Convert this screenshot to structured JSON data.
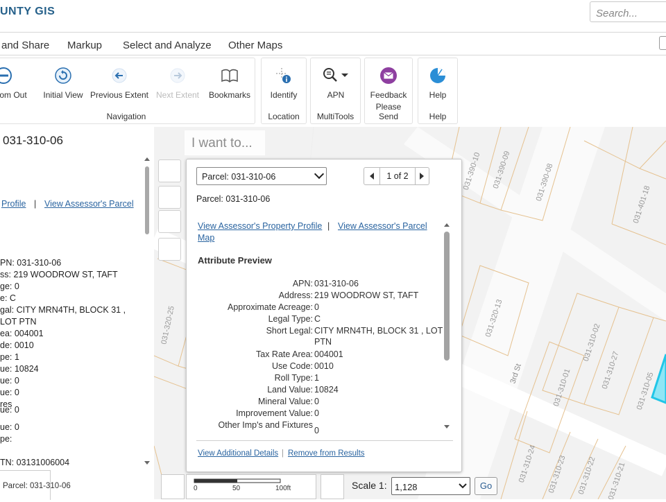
{
  "header": {
    "brand": "UNTY GIS",
    "search_placeholder": "Search..."
  },
  "menu": {
    "items": [
      "and Share",
      "Markup",
      "Select and Analyze",
      "Other Maps"
    ]
  },
  "toolbar": {
    "navigation": {
      "label": "Navigation",
      "tools": [
        {
          "label": "om Out",
          "icon": "zoom-out-icon",
          "enabled": true
        },
        {
          "label": "Initial View",
          "icon": "initial-view-icon",
          "enabled": true
        },
        {
          "label": "Previous Extent",
          "icon": "previous-extent-icon",
          "enabled": true
        },
        {
          "label": "Next Extent",
          "icon": "next-extent-icon",
          "enabled": false
        },
        {
          "label": "Bookmarks",
          "icon": "bookmarks-icon",
          "enabled": true
        }
      ]
    },
    "location": {
      "label": "Location",
      "tool": "Identify",
      "icon": "identify-icon"
    },
    "multitools": {
      "label": "MultiTools",
      "tool": "APN",
      "icon": "apn-search-icon"
    },
    "please_send": {
      "label": "Please Send",
      "tool": "Feedback",
      "icon": "feedback-icon"
    },
    "help": {
      "label": "Help",
      "tool": "Help",
      "icon": "help-icon"
    }
  },
  "left_panel": {
    "title": "031-310-06",
    "link_profile": "Profile",
    "separator": "|",
    "link_parcel": "View Assessor's Parcel",
    "rows": [
      "PN: 031-310-06",
      "ss: 219 WOODROW ST, TAFT",
      "ge: 0",
      "e: C",
      "gal: CITY MRN4TH, BLOCK 31 ,",
      "      LOT PTN",
      "ea: 004001",
      "de: 0010",
      "pe: 1",
      "ue: 10824",
      "ue: 0",
      "ue: 0",
      "res",
      "ue: 0",
      "ue: 0",
      "pe:",
      "TN: 03131006004"
    ],
    "footer": "Parcel: 031-310-06"
  },
  "map": {
    "i_want_to": "I want to...",
    "street_label": "3rd St",
    "parcel_labels": [
      "031-390-10",
      "031-390-09",
      "031-390-08",
      "031-401-18",
      "031-320-25",
      "031-320-13",
      "031-310-02",
      "031-310-27",
      "031-310-05",
      "031-310-01",
      "031-310-24",
      "031-310-23",
      "031-310-22",
      "031-310-21"
    ]
  },
  "popup": {
    "select_value": "Parcel: 031-310-06",
    "pager": "1 of 2",
    "parcel_heading": "Parcel: 031-310-06",
    "link_profile": "View Assessor's Property Profile",
    "separator": "|",
    "link_parcel_line1": "View Assessor's Parcel",
    "link_parcel_line2": "Map",
    "attr_heading": "Attribute Preview",
    "attributes": [
      {
        "label": "APN:",
        "value": "031-310-06"
      },
      {
        "label": "Address:",
        "value": "219 WOODROW ST, TAFT"
      },
      {
        "label": "Approximate Acreage:",
        "value": "0"
      },
      {
        "label": "Legal Type:",
        "value": "C"
      },
      {
        "label": "Short Legal:",
        "value": "CITY MRN4TH, BLOCK 31 , LOT"
      },
      {
        "label": "",
        "value": "PTN"
      },
      {
        "label": "Tax Rate Area:",
        "value": "004001"
      },
      {
        "label": "Use Code:",
        "value": "0010"
      },
      {
        "label": "Roll Type:",
        "value": "1"
      },
      {
        "label": "Land Value:",
        "value": "10824"
      },
      {
        "label": "Mineral Value:",
        "value": "0"
      },
      {
        "label": "Improvement Value:",
        "value": "0"
      },
      {
        "label": "Other Imp's and Fixtures",
        "value": "0"
      }
    ],
    "footer_link_details": "View Additional Details",
    "footer_sep": "|",
    "footer_link_remove": "Remove from Results"
  },
  "scale": {
    "ticks": [
      "0",
      "50",
      "100ft"
    ],
    "label": "Scale 1:",
    "value": "1,128",
    "go": "Go"
  },
  "colors": {
    "brand": "#25608a",
    "link": "#2a64a0",
    "parcel_line": "#e5c18f",
    "selected_parcel": "#3fd5ef",
    "feedback": "#8e3fa0",
    "help": "#2b8ed6"
  }
}
